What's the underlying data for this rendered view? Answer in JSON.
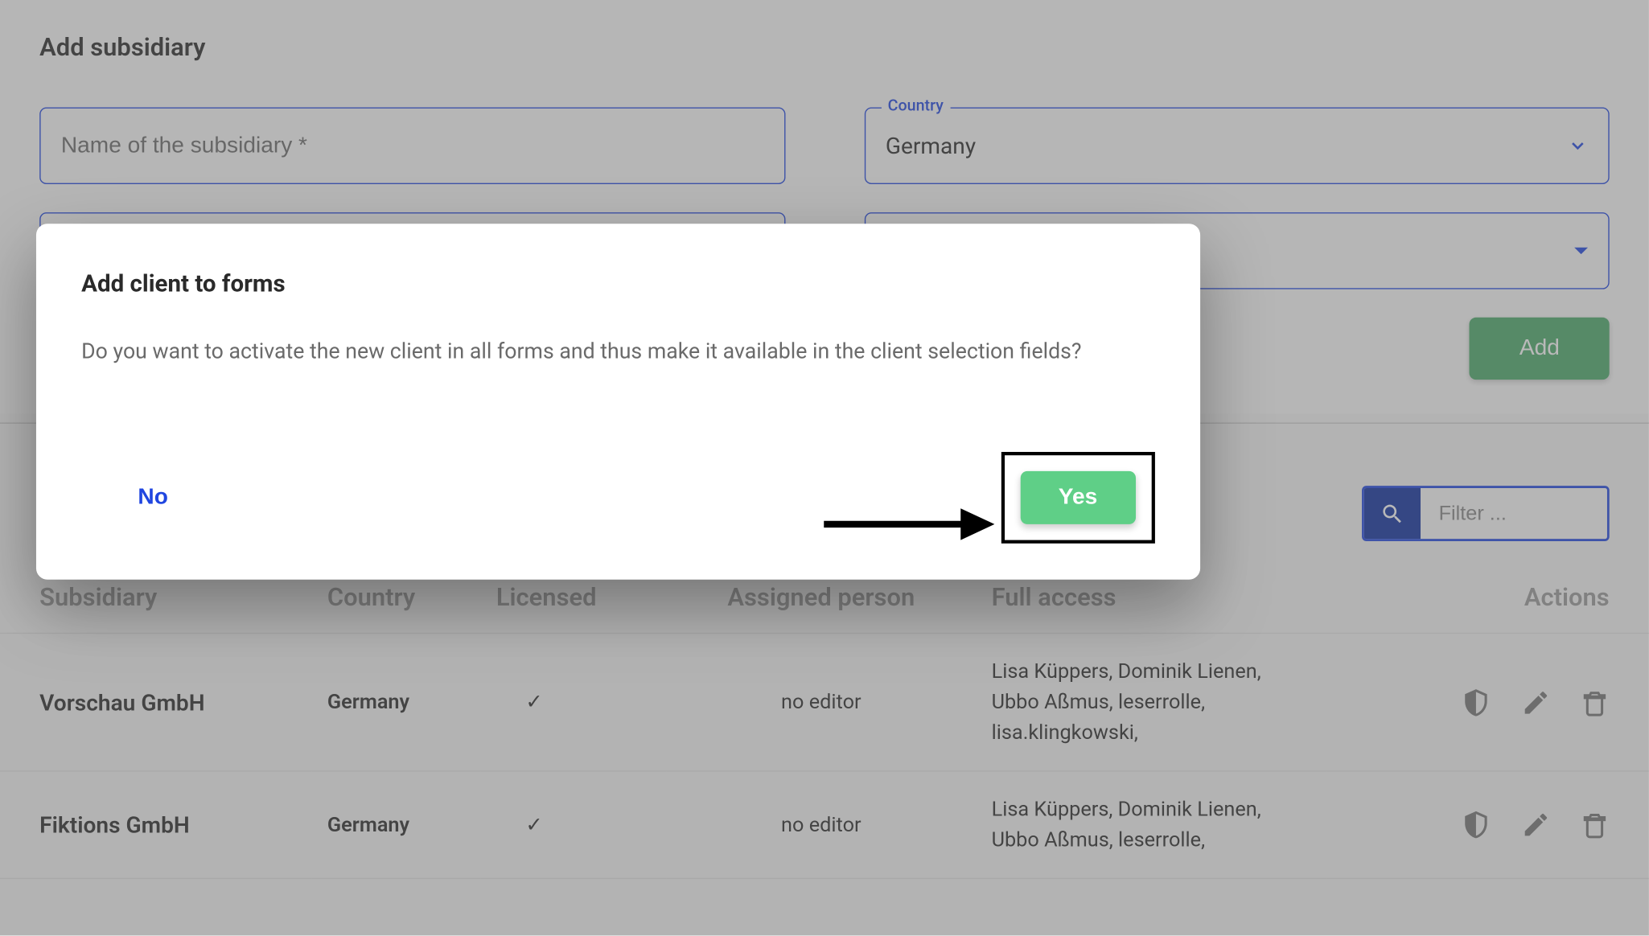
{
  "pageTitle": "Add subsidiary",
  "form": {
    "subsidiaryName": {
      "placeholder": "Name of the subsidiary *",
      "value": ""
    },
    "country": {
      "label": "Country",
      "value": "Germany"
    }
  },
  "addButton": "Add",
  "filter": {
    "placeholder": "Filter ..."
  },
  "modal": {
    "title": "Add client to forms",
    "body": "Do you want to activate the new client in all forms and thus make it available in the client selection fields?",
    "noLabel": "No",
    "yesLabel": "Yes"
  },
  "table": {
    "headers": {
      "subsidiary": "Subsidiary",
      "country": "Country",
      "licensed": "Licensed",
      "assigned": "Assigned person",
      "access": "Full access",
      "actions": "Actions"
    },
    "rows": [
      {
        "subsidiary": "Vorschau GmbH",
        "country": "Germany",
        "licensed": "✓",
        "assigned": "no editor",
        "access": "Lisa Küppers, Dominik Lienen, Ubbo Aßmus, leserrolle, lisa.klingkowski,"
      },
      {
        "subsidiary": "Fiktions GmbH",
        "country": "Germany",
        "licensed": "✓",
        "assigned": "no editor",
        "access": "Lisa Küppers, Dominik Lienen, Ubbo Aßmus, leserrolle,"
      }
    ]
  }
}
